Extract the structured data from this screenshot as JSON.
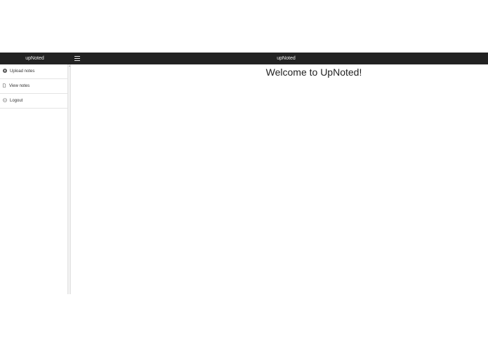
{
  "app": {
    "brand": "upNoted",
    "title": "upNoted"
  },
  "sidebar": {
    "items": [
      {
        "label": "Upload notes",
        "icon": "upload-circle-icon"
      },
      {
        "label": "View notes",
        "icon": "document-icon"
      },
      {
        "label": "Logout",
        "icon": "logout-icon"
      }
    ]
  },
  "main": {
    "heading": "Welcome to UpNoted!"
  },
  "colors": {
    "topbar": "#222222",
    "text": "#222222"
  }
}
